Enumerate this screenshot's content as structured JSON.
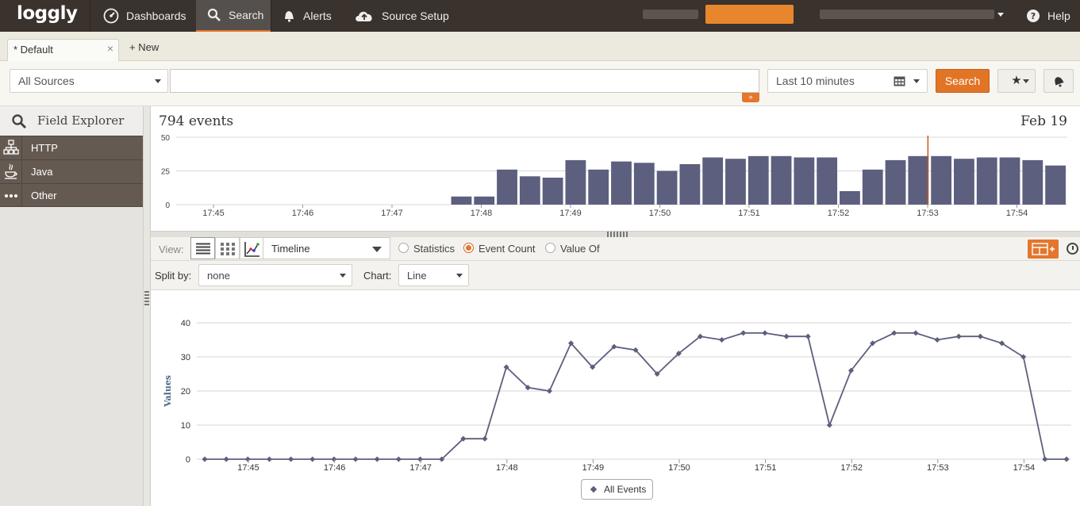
{
  "nav": {
    "logo": "loggly",
    "items": [
      {
        "label": "Dashboards",
        "icon": "dashboard-icon"
      },
      {
        "label": "Search",
        "icon": "search-icon",
        "active": true
      },
      {
        "label": "Alerts",
        "icon": "bell-icon"
      },
      {
        "label": "Source Setup",
        "icon": "cloud-upload-icon"
      }
    ],
    "help": "Help"
  },
  "tabs": {
    "current": "* Default",
    "close": "×",
    "new": "+ New"
  },
  "search": {
    "sources": "All Sources",
    "query": "",
    "expand_glyph": "»",
    "time_range": "Last 10 minutes",
    "button": "Search",
    "star_glyph": "★"
  },
  "field_explorer": {
    "title": "Field Explorer",
    "items": [
      {
        "label": "HTTP",
        "icon": "network-icon"
      },
      {
        "label": "Java",
        "icon": "java-cup-icon"
      },
      {
        "label": "Other",
        "icon": "ellipsis-icon"
      }
    ]
  },
  "histogram": {
    "count_label": "794 events",
    "date": "Feb 19"
  },
  "view": {
    "label": "View:",
    "mode": "Timeline",
    "options": [
      "Statistics",
      "Event Count",
      "Value Of"
    ],
    "selected": "Event Count"
  },
  "split": {
    "label": "Split by:",
    "value": "none",
    "chart_label": "Chart:",
    "chart_value": "Line"
  },
  "colors": {
    "accent": "#e4762d",
    "nav_bg": "#3a322d",
    "bar": "#5c5f7d",
    "sidebar_item": "#655a52"
  },
  "chart_data": [
    {
      "type": "bar",
      "title": "",
      "xlabel": "",
      "ylabel": "",
      "ylim": [
        0,
        50
      ],
      "yticks": [
        0,
        25,
        50
      ],
      "xticks": [
        "17:45",
        "17:46",
        "17:47",
        "17:48",
        "17:49",
        "17:50",
        "17:51",
        "17:52",
        "17:53",
        "17:54"
      ],
      "values": [
        0,
        0,
        0,
        0,
        0,
        0,
        0,
        0,
        0,
        0,
        0,
        0,
        6,
        6,
        26,
        21,
        20,
        33,
        26,
        32,
        31,
        25,
        30,
        35,
        34,
        36,
        36,
        35,
        35,
        10,
        26,
        33,
        36,
        36,
        34,
        35,
        35,
        33,
        29
      ],
      "marker_index": 32
    },
    {
      "type": "line",
      "title": "",
      "xlabel": "",
      "ylabel": "Values",
      "ylim": [
        0,
        40
      ],
      "yticks": [
        0,
        10,
        20,
        30,
        40
      ],
      "xticks": [
        "17:45",
        "17:46",
        "17:47",
        "17:48",
        "17:49",
        "17:50",
        "17:51",
        "17:52",
        "17:53",
        "17:54"
      ],
      "legend": "All Events",
      "series": [
        {
          "name": "All Events",
          "values": [
            0,
            0,
            0,
            0,
            0,
            0,
            0,
            0,
            0,
            0,
            0,
            0,
            6,
            6,
            27,
            21,
            20,
            34,
            27,
            33,
            32,
            25,
            31,
            36,
            35,
            37,
            37,
            36,
            36,
            10,
            26,
            34,
            37,
            37,
            35,
            36,
            36,
            34,
            30,
            0,
            0
          ]
        }
      ]
    }
  ]
}
